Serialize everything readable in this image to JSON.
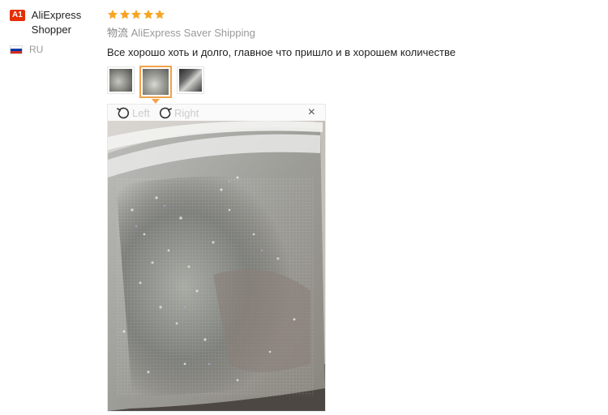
{
  "user": {
    "badge": "A1",
    "name": "AliExpress Shopper",
    "country_code": "RU",
    "flag_colors": [
      "#ffffff",
      "#0039a6",
      "#d52b1e"
    ]
  },
  "review": {
    "rating": 5,
    "star_color": "#f6a623",
    "logistics_prefix": "物流",
    "shipping": "AliExpress Saver Shipping",
    "text": "Все хорошо хоть и долго, главное что пришло и в хорошем количестве",
    "thumbnails": [
      {
        "selected": false
      },
      {
        "selected": true
      },
      {
        "selected": false
      }
    ]
  },
  "viewer": {
    "rotate_left_label": "Left",
    "rotate_right_label": "Right",
    "close_glyph": "×",
    "accent": "#f2a24a"
  }
}
